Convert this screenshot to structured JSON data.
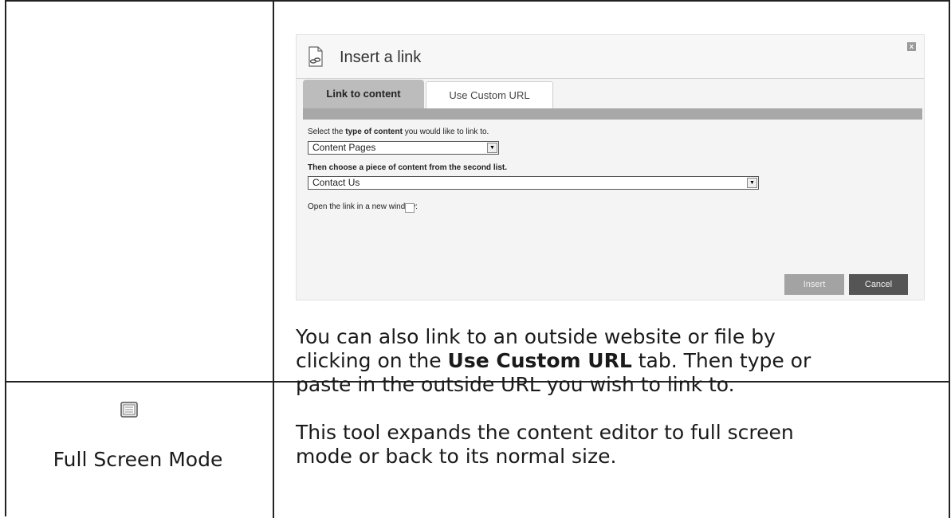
{
  "dialog": {
    "title": "Insert a link",
    "close_glyph": "x",
    "icon": "document-link-icon",
    "tabs": [
      {
        "label": "Link to content",
        "active": true
      },
      {
        "label": "Use Custom URL",
        "active": false
      }
    ],
    "type_prompt_pre": "Select the ",
    "type_prompt_bold": "type of content",
    "type_prompt_post": " you would like to link to.",
    "type_select_value": "Content Pages",
    "piece_prompt": "Then choose a piece of content from the second list.",
    "piece_select_value": "Contact Us",
    "new_window_label": "Open the link in a new window:",
    "new_window_checked": false,
    "insert_label": "Insert",
    "cancel_label": "Cancel"
  },
  "custom_url_paragraph": {
    "line1": "You can also link to an outside website or file by",
    "line2_pre": "clicking on the ",
    "line2_bold": "Use Custom URL",
    "line2_post": " tab. Then type or",
    "line3": "paste in the outside URL you wish to link to."
  },
  "full_screen": {
    "icon": "full-screen-icon",
    "label": "Full Screen Mode",
    "description_line1": "This tool expands the content editor to full screen",
    "description_line2": "mode or back to its normal size."
  },
  "colors": {
    "border": "#222222",
    "active_tab": "#bcbcbc",
    "strip": "#a8a8a8",
    "cancel_button": "#555555",
    "insert_button": "#a3a3a3"
  }
}
